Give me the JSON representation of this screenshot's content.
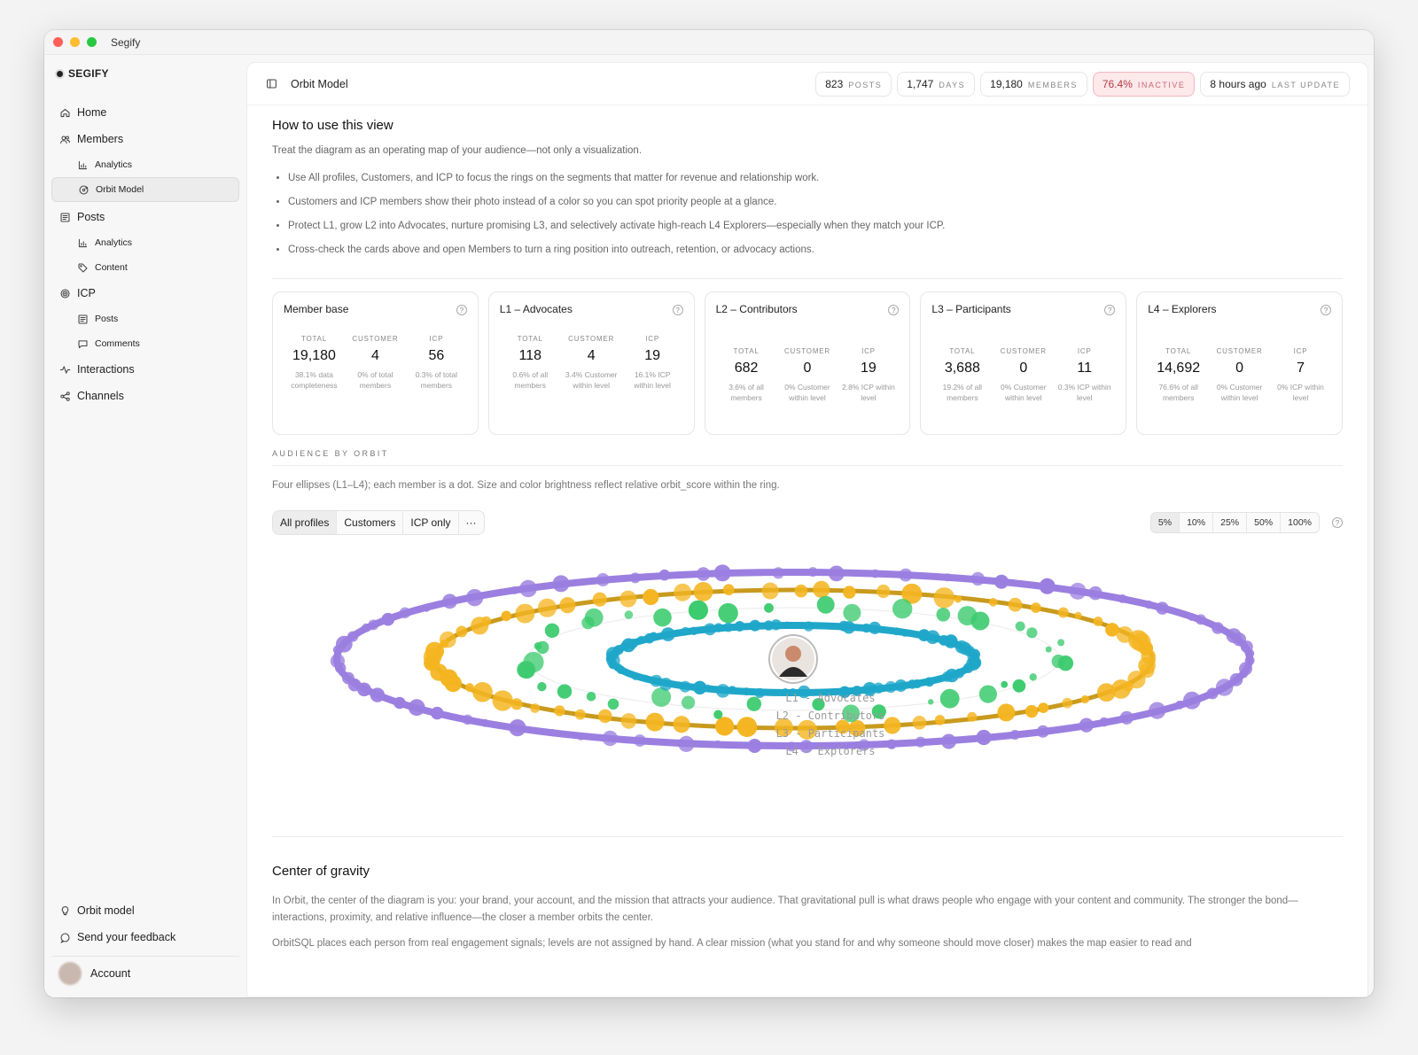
{
  "window": {
    "app_title": "Segify"
  },
  "sidebar": {
    "brand": "SEGIFY",
    "items": [
      {
        "label": "Home",
        "icon": "home-icon",
        "sub": false,
        "active": false
      },
      {
        "label": "Members",
        "icon": "users-icon",
        "sub": false,
        "active": false
      },
      {
        "label": "Analytics",
        "icon": "bar-chart-icon",
        "sub": true,
        "active": false
      },
      {
        "label": "Orbit Model",
        "icon": "orbit-icon",
        "sub": true,
        "active": true
      },
      {
        "label": "Posts",
        "icon": "posts-icon",
        "sub": false,
        "active": false
      },
      {
        "label": "Analytics",
        "icon": "bar-chart-icon",
        "sub": true,
        "active": false
      },
      {
        "label": "Content",
        "icon": "tag-icon",
        "sub": true,
        "active": false
      },
      {
        "label": "ICP",
        "icon": "target-icon",
        "sub": false,
        "active": false
      },
      {
        "label": "Posts",
        "icon": "posts-icon",
        "sub": true,
        "active": false
      },
      {
        "label": "Comments",
        "icon": "comment-icon",
        "sub": true,
        "active": false
      },
      {
        "label": "Interactions",
        "icon": "activity-icon",
        "sub": false,
        "active": false
      },
      {
        "label": "Channels",
        "icon": "share-icon",
        "sub": false,
        "active": false
      }
    ],
    "bottom": {
      "orbit_model": "Orbit model",
      "feedback": "Send your feedback",
      "account": "Account"
    }
  },
  "topbar": {
    "title": "Orbit Model",
    "stats": [
      {
        "value": "823",
        "label": "POSTS",
        "warn": false
      },
      {
        "value": "1,747",
        "label": "DAYS",
        "warn": false
      },
      {
        "value": "19,180",
        "label": "MEMBERS",
        "warn": false
      },
      {
        "value": "76.4%",
        "label": "INACTIVE",
        "warn": true
      },
      {
        "value": "8 hours ago",
        "label": "LAST UPDATE",
        "warn": false
      }
    ]
  },
  "howto": {
    "title": "How to use this view",
    "intro": "Treat the diagram as an operating map of your audience—not only a visualization.",
    "bullets": [
      "Use All profiles, Customers, and ICP to focus the rings on the segments that matter for revenue and relationship work.",
      "Customers and ICP members show their photo instead of a color so you can spot priority people at a glance.",
      "Protect L1, grow L2 into Advocates, nurture promising L3, and selectively activate high-reach L4 Explorers—especially when they match your ICP.",
      "Cross-check the cards above and open Members to turn a ring position into outreach, retention, or advocacy actions."
    ]
  },
  "cards": [
    {
      "title": "Member base",
      "metrics": [
        {
          "label": "TOTAL",
          "value": "19,180",
          "note": "38.1% data completeness"
        },
        {
          "label": "CUSTOMER",
          "value": "4",
          "note": "0% of total members"
        },
        {
          "label": "ICP",
          "value": "56",
          "note": "0.3% of total members"
        }
      ]
    },
    {
      "title": "L1 – Advocates",
      "metrics": [
        {
          "label": "TOTAL",
          "value": "118",
          "note": "0.6% of all members"
        },
        {
          "label": "CUSTOMER",
          "value": "4",
          "note": "3.4% Customer within level"
        },
        {
          "label": "ICP",
          "value": "19",
          "note": "16.1% ICP within level"
        }
      ]
    },
    {
      "title": "L2 – Contributors",
      "metrics": [
        {
          "label": "TOTAL",
          "value": "682",
          "note": "3.6% of all members"
        },
        {
          "label": "CUSTOMER",
          "value": "0",
          "note": "0% Customer within level"
        },
        {
          "label": "ICP",
          "value": "19",
          "note": "2.8% ICP within level"
        }
      ]
    },
    {
      "title": "L3 – Participants",
      "metrics": [
        {
          "label": "TOTAL",
          "value": "3,688",
          "note": "19.2% of all members"
        },
        {
          "label": "CUSTOMER",
          "value": "0",
          "note": "0% Customer within level"
        },
        {
          "label": "ICP",
          "value": "11",
          "note": "0.3% ICP within level"
        }
      ]
    },
    {
      "title": "L4 – Explorers",
      "metrics": [
        {
          "label": "TOTAL",
          "value": "14,692",
          "note": "76.6% of all members"
        },
        {
          "label": "CUSTOMER",
          "value": "0",
          "note": "0% Customer within level"
        },
        {
          "label": "ICP",
          "value": "7",
          "note": "0% ICP within level"
        }
      ]
    }
  ],
  "audience": {
    "caption": "AUDIENCE BY ORBIT",
    "description": "Four ellipses (L1–L4); each member is a dot. Size and color brightness reflect relative orbit_score within the ring.",
    "filters": [
      "All profiles",
      "Customers",
      "ICP only",
      "···"
    ],
    "active_filter": "All profiles",
    "sample_sizes": [
      "5%",
      "10%",
      "25%",
      "50%",
      "100%"
    ],
    "active_sample": "5%",
    "ring_labels": [
      "L1 - Advocates",
      "L2 - Contributors",
      "L3 - Participants",
      "L4 - Explorers"
    ],
    "ring_colors": {
      "L1": "#1fa7c9",
      "L2": "#3dcb6f",
      "L3": "#f4b521",
      "L4": "#9b7fe0"
    }
  },
  "gravity": {
    "title": "Center of gravity",
    "p1": "In Orbit, the center of the diagram is you: your brand, your account, and the mission that attracts your audience. That gravitational pull is what draws people who engage with your content and community. The stronger the bond—interactions, proximity, and relative influence—the closer a member orbits the center.",
    "p2": "OrbitSQL places each person from real engagement signals; levels are not assigned by hand. A clear mission (what you stand for and why someone should move closer) makes the map easier to read and"
  }
}
